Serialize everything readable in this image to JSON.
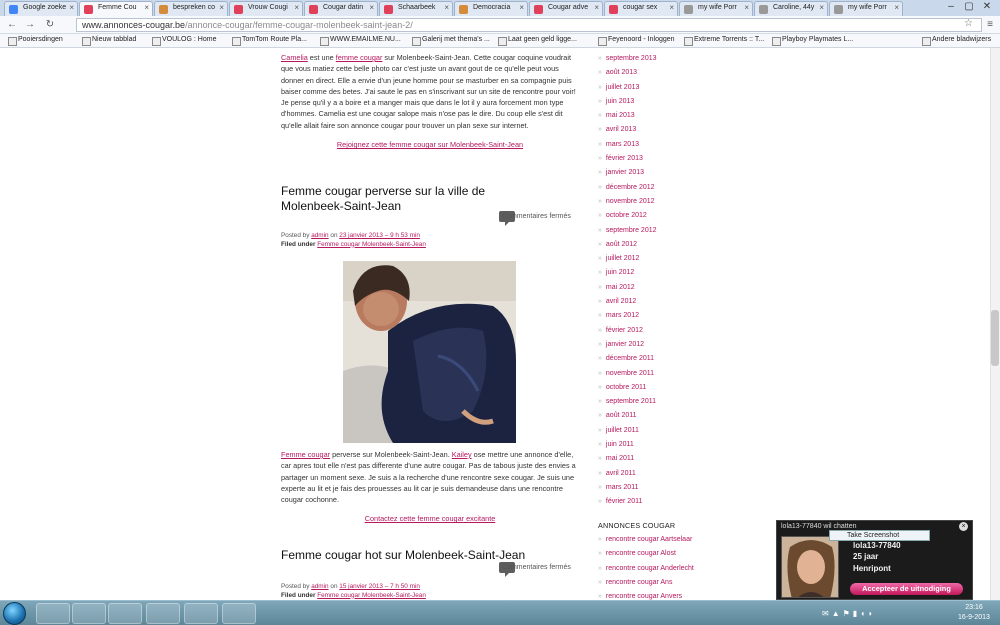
{
  "browser": {
    "tabs": [
      {
        "label": "Google zoeke",
        "icon": "google-icon",
        "color": "#4285f4"
      },
      {
        "label": "Femme Cou",
        "icon": "heart-icon",
        "color": "#e0405a",
        "active": true
      },
      {
        "label": "bespreken co",
        "icon": "site-icon",
        "color": "#d48c3a"
      },
      {
        "label": "Vrouw Cougi",
        "icon": "heart-icon",
        "color": "#e0405a"
      },
      {
        "label": "Cougar datin",
        "icon": "heart-icon",
        "color": "#e0405a"
      },
      {
        "label": "Schaarbeek",
        "icon": "heart-icon",
        "color": "#e0405a"
      },
      {
        "label": "Democracia",
        "icon": "site-icon",
        "color": "#d48c3a"
      },
      {
        "label": "Cougar adve",
        "icon": "heart-icon",
        "color": "#e0405a"
      },
      {
        "label": "cougar sex",
        "icon": "site-icon",
        "color": "#e0405a"
      },
      {
        "label": "my wife Porr",
        "icon": "page-icon",
        "color": "#999999"
      },
      {
        "label": "Caroline, 44y",
        "icon": "page-icon",
        "color": "#999999"
      },
      {
        "label": "my wife Porr",
        "icon": "page-icon",
        "color": "#999999"
      }
    ],
    "url_domain": "www.annonces-cougar.be",
    "url_path": "/annonce-cougar/femme-cougar-molenbeek-saint-jean-2/",
    "bookmarks": [
      "Pooiersdingen",
      "Nieuw tabblad",
      "VOULOG : Home",
      "TomTom Route Pla...",
      "WWW.EMAILME.NU...",
      "Galerij met thema's ...",
      "Laat geen geld ligge...",
      "Feyenoord - Inloggen",
      "Extreme Torrents :: T...",
      "Playboy Playmates L...",
      "Andere bladwijzers"
    ]
  },
  "post1": {
    "name_link": "Camelia",
    "text_a": " est une ",
    "type_link": "femme cougar",
    "text_b": " sur Molenbeek-Saint-Jean. Cette cougar coquine voudrait que vous matiez cette belle photo car c'est juste un avant gout de ce qu'elle peut vous donner en direct. Elle a envie d'un jeune homme pour se masturber en sa compagnie puis baiser comme des betes. J'ai saute le pas en s'inscrivant sur un site de rencontre pour voir! Je pense qu'il y a a boire et a manger mais que dans le lot il y aura forcement mon type d'hommes. Camelia est une cougar salope mais n'ose pas le dire. Du coup elle s'est dit qu'elle allait faire son annonce cougar pour trouver un plan sexe sur internet.",
    "cta": "Rejoignez cette femme cougar sur Molenbeek-Saint-Jean"
  },
  "post2": {
    "title": "Femme cougar perverse sur la ville de Molenbeek-Saint-Jean",
    "comments": "Commentaires fermés",
    "posted_by_prefix": "Posted by ",
    "author": "admin",
    "date_prefix": " on ",
    "date": "23 janvier 2013 – 9 h 53 min",
    "filed_label": "Filed under ",
    "category": "Femme cougar Molenbeek-Saint-Jean",
    "type_link": "Femme cougar",
    "text_a": " perverse sur Molenbeek-Saint-Jean. ",
    "name_link": "Kailey",
    "text_b": " ose mettre une annonce d'elle, car apres tout elle n'est pas differente d'une autre cougar. Pas de tabous juste des envies a partager un moment sexe. Je suis a la recherche d'une rencontre sexe cougar. Je suis une experte au lit et je fais des prouesses au lit car je suis demandeuse dans une rencontre cougar cochonne.",
    "cta": "Contactez cette femme cougar excitante"
  },
  "post3": {
    "title": "Femme cougar hot sur Molenbeek-Saint-Jean",
    "comments": "Commentaires fermés",
    "posted_by_prefix": "Posted by ",
    "author": "admin",
    "date_prefix": " on ",
    "date": "15 janvier 2013 – 7 h 50 min",
    "filed_label": "Filed under ",
    "category": "Femme cougar Molenbeek-Saint-Jean"
  },
  "sidebar": {
    "archives": [
      "septembre 2013",
      "août 2013",
      "juillet 2013",
      "juin 2013",
      "mai 2013",
      "avril 2013",
      "mars 2013",
      "février 2013",
      "janvier 2013",
      "décembre 2012",
      "novembre 2012",
      "octobre 2012",
      "septembre 2012",
      "août 2012",
      "juillet 2012",
      "juin 2012",
      "mai 2012",
      "avril 2012",
      "mars 2012",
      "février 2012",
      "janvier 2012",
      "décembre 2011",
      "novembre 2011",
      "octobre 2011",
      "septembre 2011",
      "août 2011",
      "juillet 2011",
      "juin 2011",
      "mai 2011",
      "avril 2011",
      "mars 2011",
      "février 2011"
    ],
    "heading": "ANNONCES COUGAR",
    "links": [
      "rencontre cougar Aartselaar",
      "rencontre cougar Alost",
      "rencontre cougar Anderlecht",
      "rencontre cougar Ans",
      "rencontre cougar Anvers"
    ]
  },
  "chat": {
    "header": "lola13-77840 wil chatten",
    "tooltip": "Take Screenshot",
    "name": "lola13-77840",
    "age": "25 jaar",
    "city": "Henripont",
    "accept": "Accepteer de uitnodiging"
  },
  "taskbar": {
    "time": "23:16",
    "date": "16-9-2013"
  },
  "colors": {
    "link": "#b5185f",
    "accent_button": "#c2185b"
  }
}
